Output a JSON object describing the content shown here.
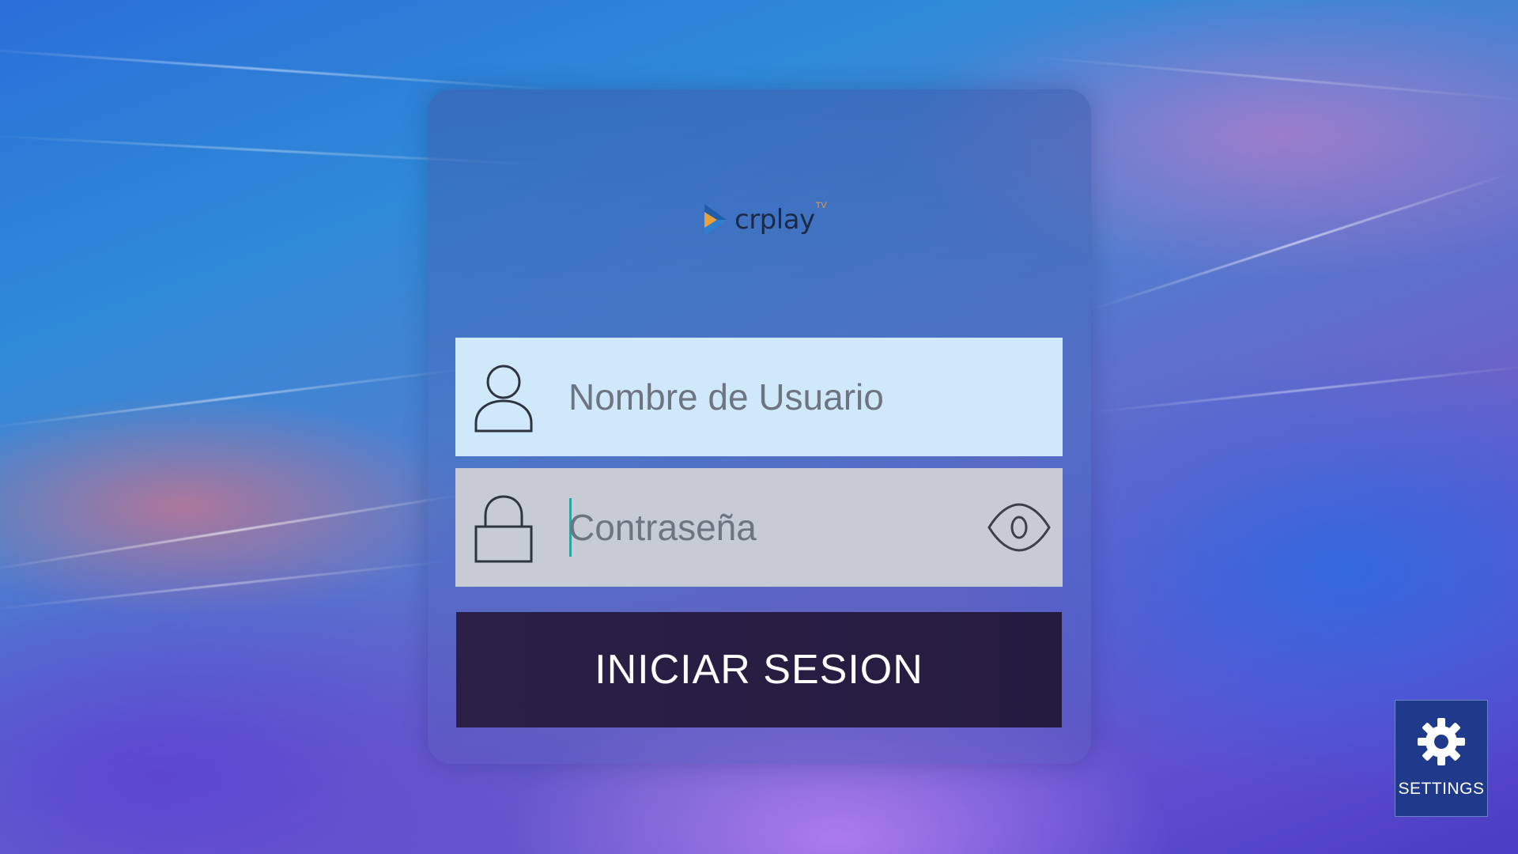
{
  "app": {
    "logo_text": "crplay",
    "logo_superscript": "TV"
  },
  "login": {
    "username_placeholder": "Nombre de Usuario",
    "username_value": "",
    "password_placeholder": "Contraseña",
    "password_value": "",
    "submit_label": "INICIAR SESION"
  },
  "settings": {
    "label": "SETTINGS"
  },
  "icons": {
    "username": "user-icon",
    "password": "lock-icon",
    "toggle_password": "eye-icon",
    "settings": "gear-icon",
    "logo": "play-icon"
  },
  "colors": {
    "username_field_bg": "#cfe9fb",
    "password_field_bg": "#c7cbd6",
    "button_bg": "#2b1f46",
    "settings_bg": "#1f3a8a",
    "logo_orange": "#e8a13a",
    "logo_blue": "#2f7fd0"
  }
}
